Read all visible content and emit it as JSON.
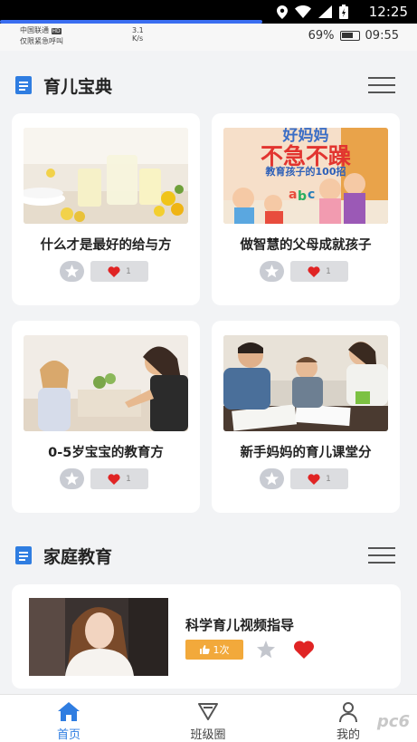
{
  "system_status": {
    "time": "12:25"
  },
  "inner_status": {
    "carrier": "中国联通",
    "carrier_badge": "HD",
    "emergency": "仅限紧急呼叫",
    "speed_value": "3.1",
    "speed_unit": "K/s",
    "battery": "69%",
    "time": "09:55"
  },
  "section1": {
    "title": "育儿宝典",
    "cards": [
      {
        "title": "什么才是最好的给与方",
        "likes": "1"
      },
      {
        "title": "做智慧的父母成就孩子",
        "likes": "1"
      },
      {
        "title": "0-5岁宝宝的教育方",
        "likes": "1"
      },
      {
        "title": "新手妈妈的育儿课堂分",
        "likes": "1"
      }
    ],
    "book_cover_text": {
      "top": "好妈妈",
      "big": "不急不躁",
      "sub": "教育孩子的100招"
    }
  },
  "section2": {
    "title": "家庭教育",
    "item": {
      "title": "科学育儿视频指导",
      "count": "1次"
    }
  },
  "tabbar": {
    "tabs": [
      {
        "label": "首页",
        "active": true
      },
      {
        "label": "班级圈",
        "active": false
      },
      {
        "label": "我的",
        "active": false
      }
    ]
  },
  "watermark": "pc6",
  "colors": {
    "primary": "#2f7de1",
    "like_red": "#e02424",
    "count_orange": "#f2a93b"
  }
}
